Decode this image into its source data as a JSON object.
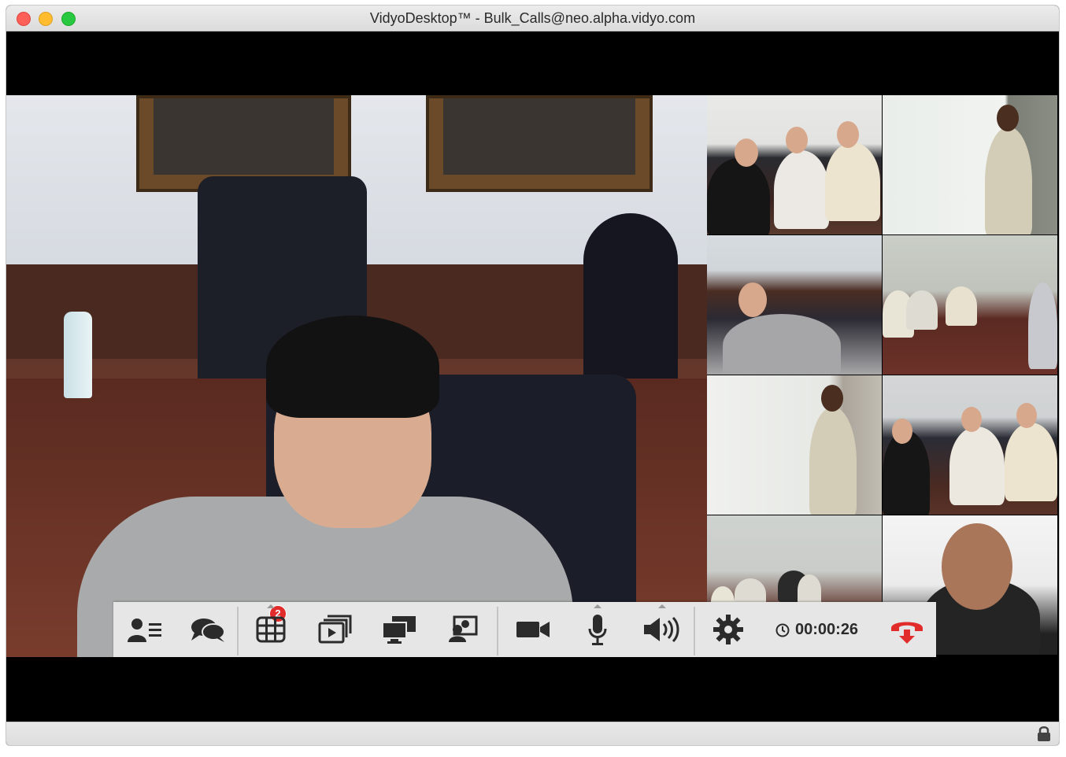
{
  "window": {
    "title": "VidyoDesktop™ - Bulk_Calls@neo.alpha.vidyo.com",
    "traffic_lights": [
      "close",
      "minimize",
      "zoom"
    ]
  },
  "video": {
    "main_participant_icon": "speaker-video",
    "tiles_count": 8
  },
  "toolbar": {
    "buttons": [
      {
        "name": "participants-button",
        "icon": "participants-list-icon"
      },
      {
        "name": "chat-button",
        "icon": "chat-bubbles-icon",
        "badge": "2"
      },
      {
        "name": "layout-button",
        "icon": "grid-icon"
      },
      {
        "name": "share-video-button",
        "icon": "stacked-media-icon"
      },
      {
        "name": "share-screen-button",
        "icon": "monitors-icon"
      },
      {
        "name": "self-view-button",
        "icon": "self-view-icon"
      },
      {
        "name": "camera-button",
        "icon": "camera-icon"
      },
      {
        "name": "microphone-button",
        "icon": "microphone-icon"
      },
      {
        "name": "speaker-button",
        "icon": "speaker-icon"
      },
      {
        "name": "settings-button",
        "icon": "gear-icon"
      }
    ],
    "timer_value": "00:00:26",
    "end_call_icon": "hang-up-icon",
    "accent": "#e22b2b"
  },
  "statusbar": {
    "lock_icon": "lock-icon"
  }
}
